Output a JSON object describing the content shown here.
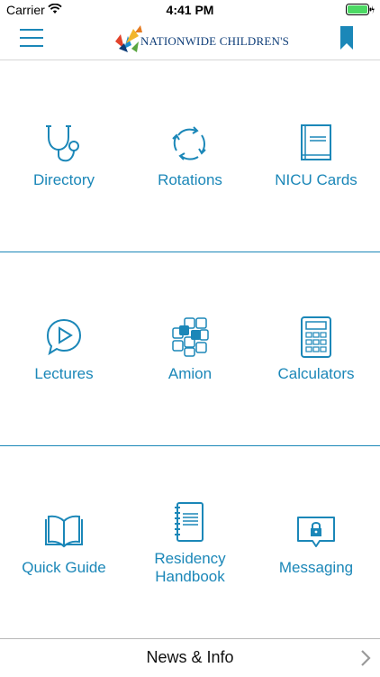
{
  "status_bar": {
    "carrier": "Carrier",
    "time": "4:41 PM"
  },
  "header": {
    "logo_text": "NATIONWIDE CHILDREN'S"
  },
  "tiles": [
    {
      "label": "Directory",
      "icon": "stethoscope-icon"
    },
    {
      "label": "Rotations",
      "icon": "rotate-arrows-icon"
    },
    {
      "label": "NICU Cards",
      "icon": "book-icon"
    },
    {
      "label": "Lectures",
      "icon": "play-bubble-icon"
    },
    {
      "label": "Amion",
      "icon": "grid-blocks-icon"
    },
    {
      "label": "Calculators",
      "icon": "calculator-icon"
    },
    {
      "label": "Quick Guide",
      "icon": "open-book-icon"
    },
    {
      "label": "Residency Handbook",
      "icon": "notebook-icon"
    },
    {
      "label": "Messaging",
      "icon": "lock-message-icon"
    }
  ],
  "footer": {
    "news_label": "News & Info"
  },
  "colors": {
    "accent": "#1b87b8",
    "logo_blue": "#0e3d78"
  }
}
